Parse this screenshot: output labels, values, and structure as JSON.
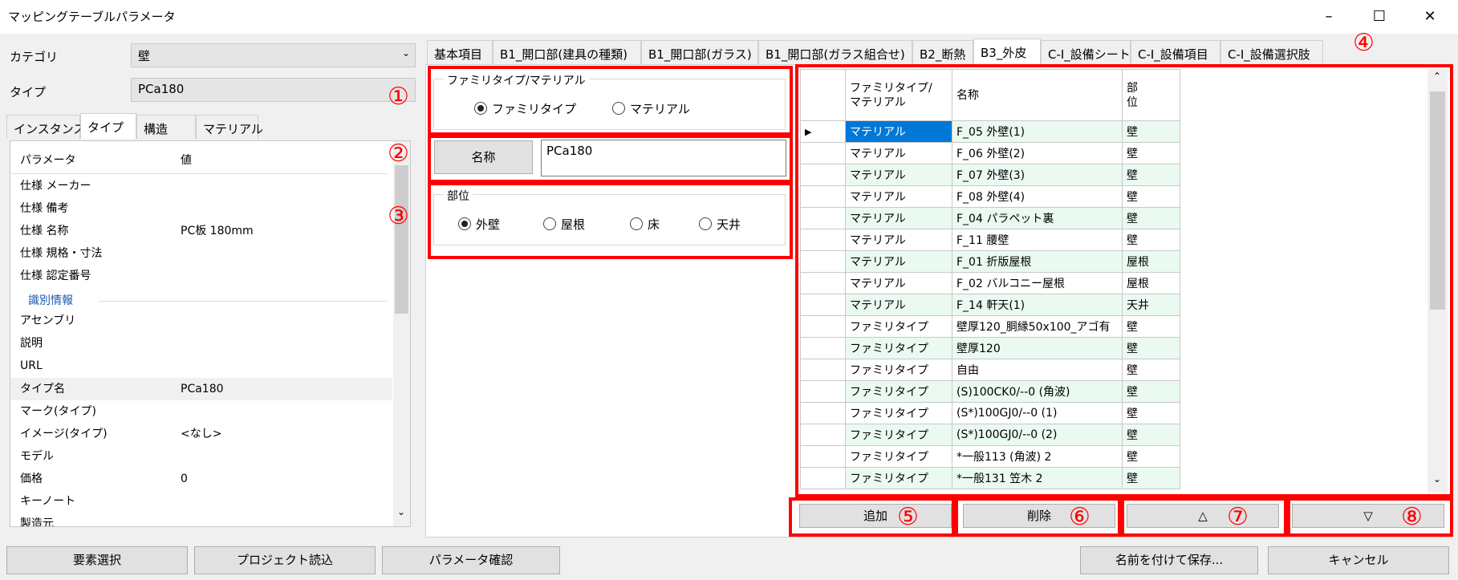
{
  "window": {
    "title": "マッピングテーブルパラメータ",
    "min": "–",
    "max": "☐",
    "close": "✕"
  },
  "left": {
    "category_label": "カテゴリ",
    "category_value": "壁",
    "type_label": "タイプ",
    "type_value": "PCa180",
    "tabs": [
      "インスタンス",
      "タイプ",
      "構造",
      "マテリアル"
    ],
    "prop_header": {
      "name": "パラメータ",
      "value": "値"
    },
    "props": [
      {
        "name": "仕様 メーカー",
        "value": ""
      },
      {
        "name": "仕様 備考",
        "value": ""
      },
      {
        "name": "仕様 名称",
        "value": "PC板 180mm"
      },
      {
        "name": "仕様 規格・寸法",
        "value": ""
      },
      {
        "name": "仕様 認定番号",
        "value": ""
      }
    ],
    "section": "識別情報",
    "props2": [
      {
        "name": "アセンブリ",
        "value": ""
      },
      {
        "name": "説明",
        "value": ""
      },
      {
        "name": "URL",
        "value": ""
      },
      {
        "name": "タイプ名",
        "value": "PCa180"
      },
      {
        "name": "マーク(タイプ)",
        "value": ""
      },
      {
        "name": "イメージ(タイプ)",
        "value": "<なし>"
      },
      {
        "name": "モデル",
        "value": ""
      },
      {
        "name": "価格",
        "value": "0"
      },
      {
        "name": "キーノート",
        "value": ""
      },
      {
        "name": "製造元",
        "value": ""
      }
    ]
  },
  "main_tabs": [
    "基本項目",
    "B1_開口部(建具の種類)",
    "B1_開口部(ガラス)",
    "B1_開口部(ガラス組合せ)",
    "B2_断熱",
    "B3_外皮",
    "C-I_設備シート",
    "C-I_設備項目",
    "C-I_設備選択肢"
  ],
  "form": {
    "group1_caption": "ファミリタイプ/マテリアル",
    "radio_family": "ファミリタイプ",
    "radio_material": "マテリアル",
    "name_button": "名称",
    "name_value": "PCa180",
    "group3_caption": "部位",
    "radio_wall": "外壁",
    "radio_roof": "屋根",
    "radio_floor": "床",
    "radio_ceiling": "天井"
  },
  "grid": {
    "headers": [
      "ファミリタイプ/\nマテリアル",
      "名称",
      "部\n位"
    ],
    "rows": [
      [
        "マテリアル",
        "F_05 外壁(1)",
        "壁"
      ],
      [
        "マテリアル",
        "F_06 外壁(2)",
        "壁"
      ],
      [
        "マテリアル",
        "F_07 外壁(3)",
        "壁"
      ],
      [
        "マテリアル",
        "F_08 外壁(4)",
        "壁"
      ],
      [
        "マテリアル",
        "F_04 パラペット裏",
        "壁"
      ],
      [
        "マテリアル",
        "F_11 腰壁",
        "壁"
      ],
      [
        "マテリアル",
        "F_01 折版屋根",
        "屋根"
      ],
      [
        "マテリアル",
        "F_02 バルコニー屋根",
        "屋根"
      ],
      [
        "マテリアル",
        "F_14 軒天(1)",
        "天井"
      ],
      [
        "ファミリタイプ",
        "壁厚120_胴縁50x100_アゴ有",
        "壁"
      ],
      [
        "ファミリタイプ",
        "壁厚120",
        "壁"
      ],
      [
        "ファミリタイプ",
        "自由",
        "壁"
      ],
      [
        "ファミリタイプ",
        "(S)100CK0/--0 (角波)",
        "壁"
      ],
      [
        "ファミリタイプ",
        "(S*)100GJ0/--0 (1)",
        "壁"
      ],
      [
        "ファミリタイプ",
        "(S*)100GJ0/--0 (2)",
        "壁"
      ],
      [
        "ファミリタイプ",
        "*一般113 (角波) 2",
        "壁"
      ],
      [
        "ファミリタイプ",
        "*一般131 笠木 2",
        "壁"
      ]
    ]
  },
  "buttons": {
    "add": "追加",
    "delete": "削除",
    "up": "△",
    "down": "▽",
    "select": "要素選択",
    "load": "プロジェクト読込",
    "check": "パラメータ確認",
    "save": "名前を付けて保存...",
    "cancel": "キャンセル"
  },
  "callouts": [
    "①",
    "②",
    "③",
    "④",
    "⑤",
    "⑥",
    "⑦",
    "⑧"
  ],
  "colors": {
    "callout": "#ff0000",
    "selection": "#0078d7",
    "alt_row": "#eafaf1"
  }
}
